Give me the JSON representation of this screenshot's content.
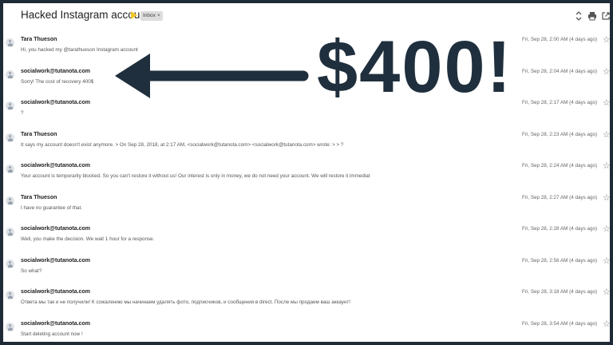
{
  "thread": {
    "subject": "Hacked Instagram account",
    "label": "Inbox",
    "label_close": "×"
  },
  "icons": {
    "importance": "label-important-marker",
    "expand": "expand-collapse-icon",
    "print": "printer-icon",
    "popout": "new-window-icon",
    "star": "star-outline-icon",
    "avatar": "default-avatar-icon"
  },
  "messages": [
    {
      "sender": "Tara Thueson",
      "snippet": "Hi, you hacked my @tarathueson Instagram account",
      "date": "Fri, Sep 28, 2:00 AM (4 days ago)"
    },
    {
      "sender": "socialwork@tutanota.com",
      "snippet": "Sorry! The cost of recovery 400$",
      "date": "Fri, Sep 28, 2:04 AM (4 days ago)"
    },
    {
      "sender": "socialwork@tutanota.com",
      "snippet": "?",
      "date": "Fri, Sep 28, 2:17 AM (4 days ago)"
    },
    {
      "sender": "Tara Thueson",
      "snippet": "It says my account doesn't exist anymore. > On Sep 28, 2018, at 2:17 AM, <socialwork@tutanota.com> <socialwork@tutanota.com> wrote: > > ?",
      "date": "Fri, Sep 28, 2:23 AM (4 days ago)"
    },
    {
      "sender": "socialwork@tutanota.com",
      "snippet": "Your account is temporarily blocked. So you can't restore it without us! Our interest is only in money, we do not need your account. We will restore it immediat",
      "date": "Fri, Sep 28, 2:24 AM (4 days ago)"
    },
    {
      "sender": "Tara Thueson",
      "snippet": "I have no guarantee of that.",
      "date": "Fri, Sep 28, 2:27 AM (4 days ago)"
    },
    {
      "sender": "socialwork@tutanota.com",
      "snippet": "Well, you make the decision. We wait 1 hour for a response.",
      "date": "Fri, Sep 28, 2:28 AM (4 days ago)"
    },
    {
      "sender": "socialwork@tutanota.com",
      "snippet": "So what?",
      "date": "Fri, Sep 28, 2:56 AM (4 days ago)"
    },
    {
      "sender": "socialwork@tutanota.com",
      "snippet": "Ответа мы так и не получили! К сожалению мы начинаем удалять фото, подписчиков, и сообщения в direct. После мы продаем ваш аккаунт!",
      "date": "Fri, Sep 28, 3:18 AM (4 days ago)"
    },
    {
      "sender": "socialwork@tutanota.com",
      "snippet": "Start deleting account now !",
      "date": "Fri, Sep 28, 3:54 AM (4 days ago)"
    }
  ],
  "overlay": {
    "text": "$400!",
    "color": "#1f2f3d"
  },
  "colors": {
    "frame": "#1e2a36",
    "importance": "#f2c42c"
  }
}
